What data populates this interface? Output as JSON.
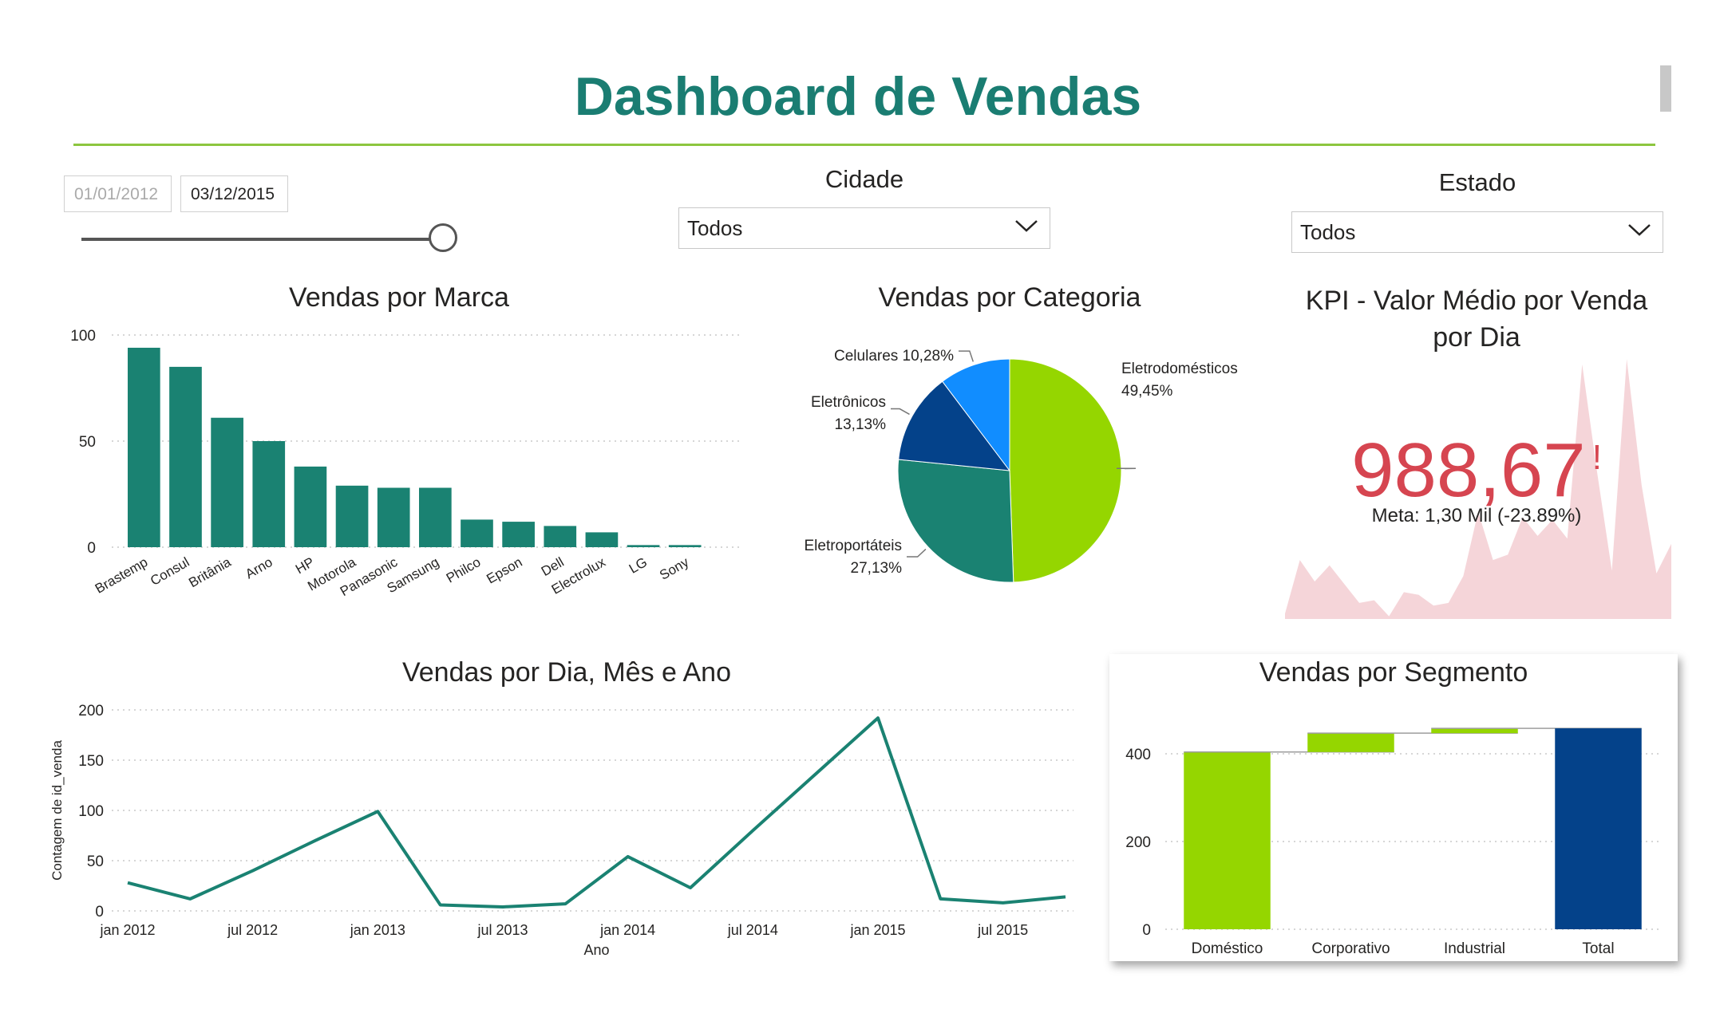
{
  "page": {
    "title": "Dashboard de Vendas"
  },
  "date_filter": {
    "start": "01/01/2012",
    "end": "03/12/2015",
    "position": 1.0
  },
  "city_filter": {
    "label": "Cidade",
    "value": "Todos"
  },
  "state_filter": {
    "label": "Estado",
    "value": "Todos"
  },
  "colors": {
    "teal": "#1a8272",
    "lime": "#95d600",
    "navy": "#04428a",
    "blue": "#118dff",
    "kpi_red": "#d64550",
    "kpi_area": "#f5d5d9"
  },
  "kpi": {
    "title_line1": "KPI - Valor Médio por Venda",
    "title_line2": "por Dia",
    "value": "988,67",
    "alert": "!",
    "goal": "Meta: 1,30 Mil (-23.89%)"
  },
  "chart_data": [
    {
      "type": "bar",
      "title": "Vendas por Marca",
      "categories": [
        "Brastemp",
        "Consul",
        "Britânia",
        "Arno",
        "HP",
        "Motorola",
        "Panasonic",
        "Samsung",
        "Philco",
        "Epson",
        "Dell",
        "Electrolux",
        "LG",
        "Sony"
      ],
      "values": [
        94,
        85,
        61,
        50,
        38,
        29,
        28,
        28,
        13,
        12,
        10,
        7,
        1,
        1
      ],
      "ylim": [
        0,
        100
      ],
      "yticks": [
        0,
        50,
        100
      ],
      "grid": true
    },
    {
      "type": "pie",
      "title": "Vendas por Categoria",
      "slices": [
        {
          "label": "Eletrodomésticos",
          "value": 49.45,
          "text": "49,45%"
        },
        {
          "label": "Eletroportáteis",
          "value": 27.13,
          "text": "27,13%"
        },
        {
          "label": "Eletrônicos",
          "value": 13.13,
          "text": "13,13%"
        },
        {
          "label": "Celulares",
          "value": 10.28,
          "text": "10,28%"
        }
      ]
    },
    {
      "type": "line",
      "title": "Vendas por Dia, Mês e Ano",
      "xlabel": "Ano",
      "ylabel": "Contagem de id_venda",
      "x": [
        "2012-01",
        "2012-04",
        "2012-07",
        "2012-10",
        "2013-01",
        "2013-04",
        "2013-07",
        "2013-10",
        "2014-01",
        "2014-04",
        "2014-07",
        "2014-10",
        "2015-01",
        "2015-04",
        "2015-07",
        "2015-10"
      ],
      "values": [
        28,
        12,
        40,
        70,
        99,
        6,
        4,
        7,
        54,
        23,
        80,
        136,
        192,
        12,
        8,
        14
      ],
      "xticks": [
        {
          "x": "2012-01",
          "label": "jan 2012"
        },
        {
          "x": "2012-07",
          "label": "jul 2012"
        },
        {
          "x": "2013-01",
          "label": "jan 2013"
        },
        {
          "x": "2013-07",
          "label": "jul 2013"
        },
        {
          "x": "2014-01",
          "label": "jan 2014"
        },
        {
          "x": "2014-07",
          "label": "jul 2014"
        },
        {
          "x": "2015-01",
          "label": "jan 2015"
        },
        {
          "x": "2015-07",
          "label": "jul 2015"
        }
      ],
      "ylim": [
        0,
        200
      ],
      "yticks": [
        0,
        50,
        100,
        150,
        200
      ],
      "grid": true
    },
    {
      "type": "bar",
      "title": "Vendas por Segmento",
      "categories": [
        "Doméstico",
        "Corporativo",
        "Industrial",
        "Total"
      ],
      "values": [
        404,
        43,
        11,
        458
      ],
      "ylim": [
        0,
        500
      ],
      "yticks": [
        0,
        200,
        400
      ],
      "grid": true
    },
    {
      "type": "area",
      "values": [
        0.02,
        0.22,
        0.14,
        0.2,
        0.13,
        0.06,
        0.07,
        0.01,
        0.1,
        0.09,
        0.05,
        0.06,
        0.16,
        0.4,
        0.22,
        0.24,
        0.38,
        0.31,
        0.37,
        0.3,
        0.95,
        0.55,
        0.18,
        0.97,
        0.5,
        0.17,
        0.28
      ],
      "ylim": [
        0,
        1
      ]
    }
  ]
}
